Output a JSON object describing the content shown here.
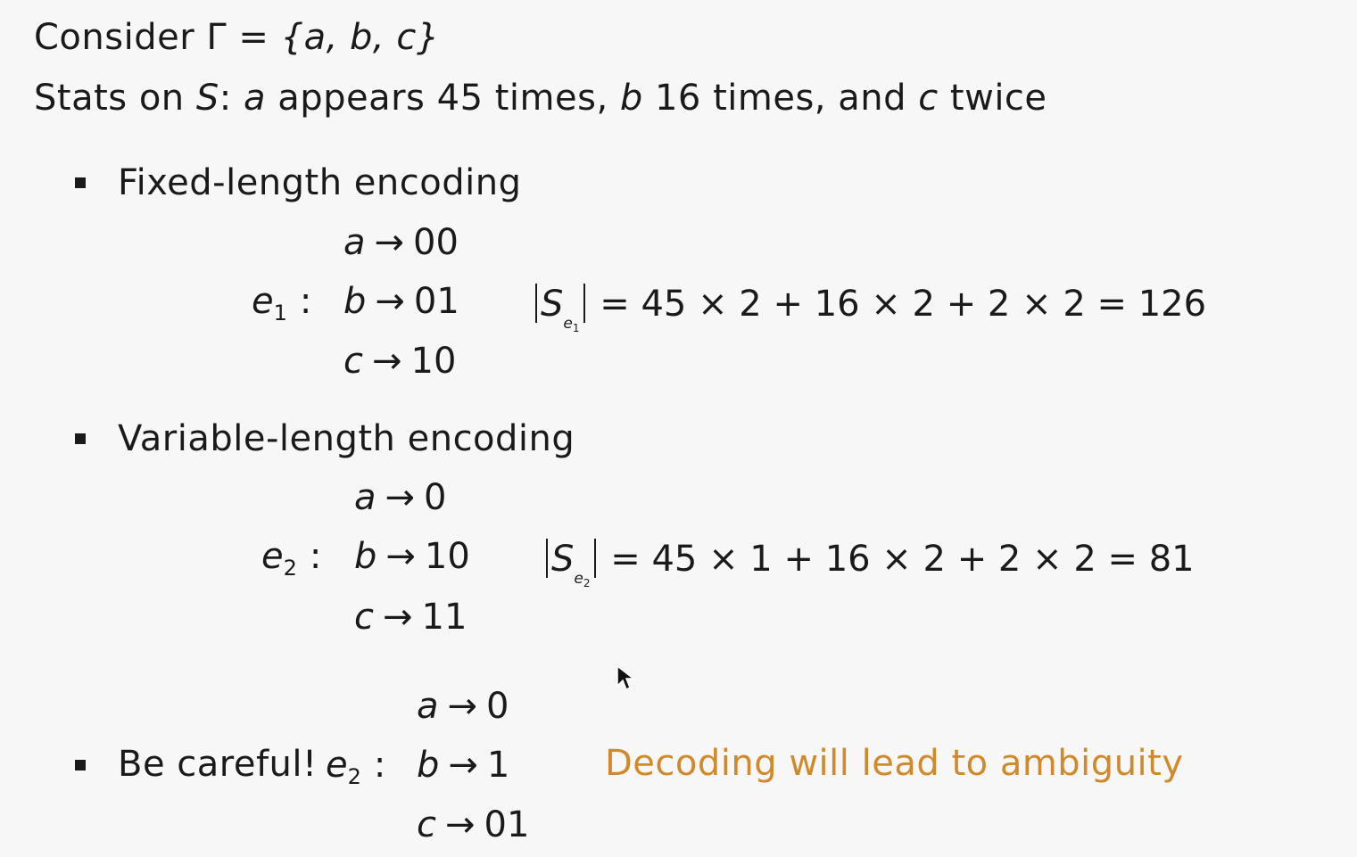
{
  "header": {
    "line1_prefix": "Consider ",
    "line1_gamma": "Γ",
    "line1_eq": " = ",
    "line1_set": "{a, b, c}",
    "line2_prefix": "Stats on ",
    "line2_S": "S",
    "line2_colon": ": ",
    "line2_a": "a",
    "line2_mid1": " appears 45 times, ",
    "line2_b": "b",
    "line2_mid2": " 16 times, and ",
    "line2_c": "c",
    "line2_end": " twice"
  },
  "sections": [
    {
      "bullet_label": "Fixed-length encoding",
      "enc_name": "e",
      "enc_sub": "1",
      "enc_colon": ":",
      "mappings": [
        {
          "sym": "a",
          "arrow": "→",
          "code": "00"
        },
        {
          "sym": "b",
          "arrow": "→",
          "code": "01"
        },
        {
          "sym": "c",
          "arrow": "→",
          "code": "10"
        }
      ],
      "size_S": "S",
      "size_e": "e",
      "size_sub": "1",
      "size_expr": "= 45 × 2 + 16 × 2 + 2 × 2 = 126"
    },
    {
      "bullet_label": "Variable-length encoding",
      "enc_name": "e",
      "enc_sub": "2",
      "enc_colon": ":",
      "mappings": [
        {
          "sym": "a",
          "arrow": "→",
          "code": "0"
        },
        {
          "sym": "b",
          "arrow": "→",
          "code": "10"
        },
        {
          "sym": "c",
          "arrow": "→",
          "code": "11"
        }
      ],
      "size_S": "S",
      "size_e": "e",
      "size_sub": "2",
      "size_expr": "= 45 × 1 + 16 × 2 + 2 × 2 = 81"
    },
    {
      "bullet_label": "Be careful!",
      "enc_name": "e",
      "enc_sub": "2",
      "enc_colon": ":",
      "mappings": [
        {
          "sym": "a",
          "arrow": "→",
          "code": "0"
        },
        {
          "sym": "b",
          "arrow": "→",
          "code": "1"
        },
        {
          "sym": "c",
          "arrow": "→",
          "code": "01"
        }
      ],
      "warning": "Decoding will lead to ambiguity"
    }
  ],
  "colors": {
    "text": "#1a1a1a",
    "accent": "#d08a2c",
    "background": "#f7f7f7"
  },
  "icons": {
    "cursor": "mouse-pointer-icon"
  }
}
